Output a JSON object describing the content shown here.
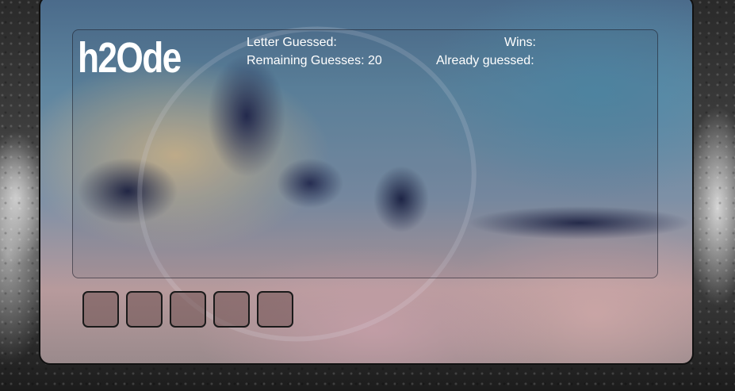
{
  "game": {
    "title": "h2Ode"
  },
  "stats": {
    "letter_guessed_label": "Letter Guessed:",
    "letter_guessed_value": "",
    "remaining_label": "Remaining Guesses:",
    "remaining_value": "20",
    "wins_label": "Wins:",
    "wins_value": "",
    "already_guessed_label": "Already guessed:",
    "already_guessed_value": ""
  },
  "word_slots": [
    "",
    "",
    "",
    "",
    ""
  ]
}
